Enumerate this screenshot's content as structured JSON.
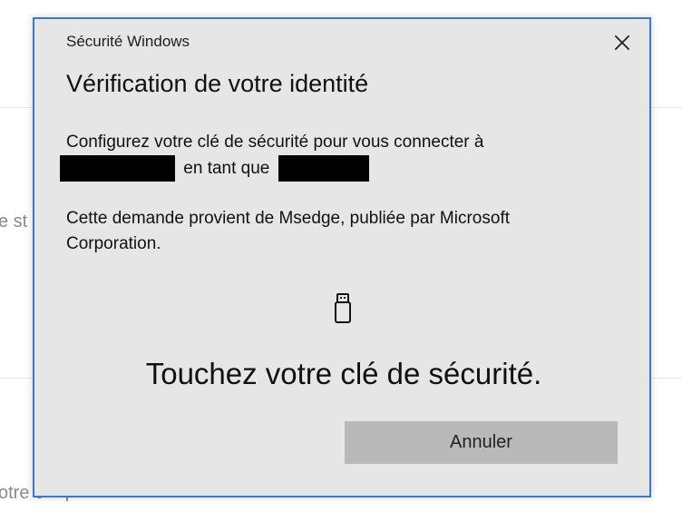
{
  "background": {
    "fragment_one": "e st",
    "fragment_two": "otre c"
  },
  "dialog": {
    "window_title": "Sécurité Windows",
    "title": "Vérification de votre identité",
    "prompt": {
      "line_one": "Configurez votre clé de sécurité pour vous connecter à",
      "connector": "en tant que"
    },
    "source_message": "Cette demande provient de Msedge, publiée par Microsoft Corporation.",
    "instruction": "Touchez votre clé de sécurité.",
    "cancel_label": "Annuler"
  },
  "icons": {
    "close": "close-icon",
    "security_key": "usb-security-key-icon"
  },
  "colors": {
    "dialog_background": "#e6e6e6",
    "dialog_border": "#3a7ac8",
    "button_background": "#b9b9b9",
    "redaction": "#000000"
  }
}
